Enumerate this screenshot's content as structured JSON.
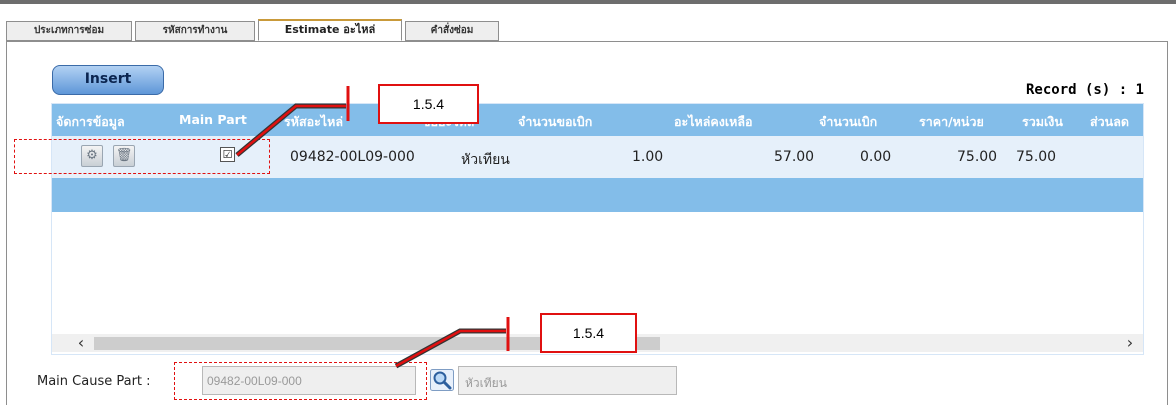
{
  "tabs": [
    {
      "label": "ประเภทการซ่อม",
      "active": false
    },
    {
      "label": "รหัสการทำงาน",
      "active": false
    },
    {
      "label": "Estimate อะไหล่",
      "active": true
    },
    {
      "label": "คำสั่งซ่อม",
      "active": false
    }
  ],
  "toolbar": {
    "insert_label": "Insert",
    "record_label": "Record (s) : 1"
  },
  "grid": {
    "columns": [
      "จัดการข้อมูล",
      "Main Part",
      "รหัสอะไหล่",
      "ชื่ออะไหล่",
      "จำนวนขอเบิก",
      "อะไหล่คงเหลือ",
      "จำนวนเบิก",
      "ราคา/หน่วย",
      "รวมเงิน",
      "ส่วนลด"
    ],
    "rows": [
      {
        "edit_icon": "gear-icon",
        "delete_icon": "trash-icon",
        "main_part_checked": true,
        "check_glyph": "☑",
        "part_code": "09482-00L09-000",
        "part_name": "หัวเทียน",
        "qty_request": "1.00",
        "qty_remaining": "57.00",
        "qty_issued": "0.00",
        "unit_price": "75.00",
        "total": "75.00"
      }
    ]
  },
  "scrollbar": {
    "left_arrow": "‹",
    "right_arrow": "›",
    "thumb_fraction": 0.56
  },
  "main_cause": {
    "label": "Main Cause Part :",
    "part_code": "09482-00L09-000",
    "part_name": "หัวเทียน",
    "search_icon": "magnifier-icon"
  },
  "annotations": [
    {
      "label": "1.5.4"
    },
    {
      "label": "1.5.4"
    }
  ],
  "colors": {
    "header_bg": "#83bde9",
    "row_bg": "#e6f0fa",
    "annotation_red": "#e01010",
    "button_blue": "#5e97d8"
  }
}
